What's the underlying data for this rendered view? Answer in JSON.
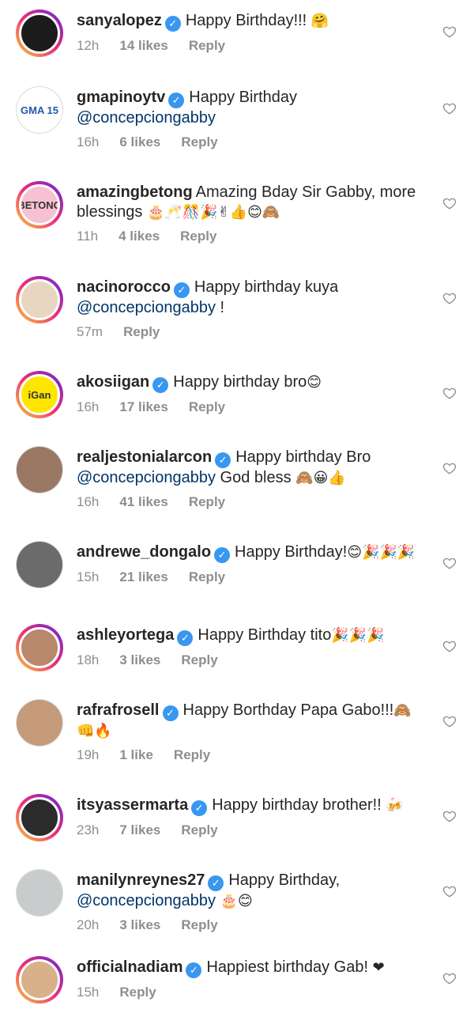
{
  "comments": [
    {
      "user": "sanyalopez",
      "verified": true,
      "parts": [
        {
          "t": "Happy Birthday!!! "
        },
        {
          "e": "🤗"
        }
      ],
      "time": "12h",
      "likes": "14 likes",
      "reply": "Reply",
      "avatar_bg": "#1c1c1c",
      "avatar_text": "",
      "ring": true
    },
    {
      "user": "gmapinoytv",
      "verified": true,
      "parts": [
        {
          "t": "Happy Birthday "
        },
        {
          "m": "@concepciongabby"
        }
      ],
      "time": "16h",
      "likes": "6 likes",
      "reply": "Reply",
      "avatar_bg": "#ffffff",
      "avatar_text": "GMA 15",
      "ring": false
    },
    {
      "user": "amazingbetong",
      "verified": false,
      "parts": [
        {
          "t": "Amazing Bday Sir Gabby, more blessings "
        },
        {
          "e": "🎂🥂🎊🎉✌👍😊🙈"
        }
      ],
      "time": "11h",
      "likes": "4 likes",
      "reply": "Reply",
      "avatar_bg": "#f6c1d3",
      "avatar_text": "BETONG",
      "ring": true
    },
    {
      "user": "nacinorocco",
      "verified": true,
      "parts": [
        {
          "t": "Happy birthday kuya "
        },
        {
          "m": "@concepciongabby"
        },
        {
          "t": " !"
        }
      ],
      "time": "57m",
      "likes": "",
      "reply": "Reply",
      "avatar_bg": "#e7d7c0",
      "avatar_text": "",
      "ring": true
    },
    {
      "user": "akosiigan",
      "verified": true,
      "parts": [
        {
          "t": "Happy birthday bro"
        },
        {
          "e": "😊"
        }
      ],
      "time": "16h",
      "likes": "17 likes",
      "reply": "Reply",
      "avatar_bg": "#ffe600",
      "avatar_text": "iGan",
      "ring": true
    },
    {
      "user": "realjestonialarcon",
      "verified": true,
      "parts": [
        {
          "t": "Happy birthday Bro "
        },
        {
          "m": "@concepciongabby"
        },
        {
          "t": " God bless "
        },
        {
          "e": "🙈😀👍"
        }
      ],
      "time": "16h",
      "likes": "41 likes",
      "reply": "Reply",
      "avatar_bg": "#9a7864",
      "avatar_text": "",
      "ring": false
    },
    {
      "user": "andrewe_dongalo",
      "verified": true,
      "parts": [
        {
          "t": "Happy Birthday!"
        },
        {
          "e": "😊🎉🎉🎉"
        }
      ],
      "time": "15h",
      "likes": "21 likes",
      "reply": "Reply",
      "avatar_bg": "#6b6b6b",
      "avatar_text": "",
      "ring": false
    },
    {
      "user": "ashleyortega",
      "verified": true,
      "parts": [
        {
          "t": "Happy Birthday tito"
        },
        {
          "e": "🎉🎉🎉"
        }
      ],
      "time": "18h",
      "likes": "3 likes",
      "reply": "Reply",
      "avatar_bg": "#b9876c",
      "avatar_text": "",
      "ring": true
    },
    {
      "user": "rafrafrosell",
      "verified": true,
      "parts": [
        {
          "t": "Happy Borthday Papa Gabo!!!"
        },
        {
          "e": "🙈👊🔥"
        }
      ],
      "time": "19h",
      "likes": "1 like",
      "reply": "Reply",
      "avatar_bg": "#c49a79",
      "avatar_text": "",
      "ring": false
    },
    {
      "user": "itsyassermarta",
      "verified": true,
      "parts": [
        {
          "t": "Happy birthday brother!! "
        },
        {
          "e": "🍻"
        }
      ],
      "time": "23h",
      "likes": "7 likes",
      "reply": "Reply",
      "avatar_bg": "#2b2b2b",
      "avatar_text": "",
      "ring": true
    },
    {
      "user": "manilynreynes27",
      "verified": true,
      "parts": [
        {
          "t": "Happy Birthday, "
        },
        {
          "m": "@concepciongabby"
        },
        {
          "t": " "
        },
        {
          "e": "🎂😊"
        }
      ],
      "time": "20h",
      "likes": "3 likes",
      "reply": "Reply",
      "avatar_bg": "#c8cccc",
      "avatar_text": "",
      "ring": false
    },
    {
      "user": "officialnadiam",
      "verified": true,
      "parts": [
        {
          "t": "Happiest birthday Gab! "
        },
        {
          "e": "❤"
        }
      ],
      "time": "15h",
      "likes": "",
      "reply": "Reply",
      "avatar_bg": "#d8b08a",
      "avatar_text": "",
      "ring": true
    }
  ],
  "colors": {
    "text": "#262626",
    "mention": "#003569",
    "meta": "#8e8e8e",
    "verified": "#3897f0"
  },
  "icons": {
    "like": "heart-outline-icon",
    "verified": "verified-badge-icon"
  }
}
